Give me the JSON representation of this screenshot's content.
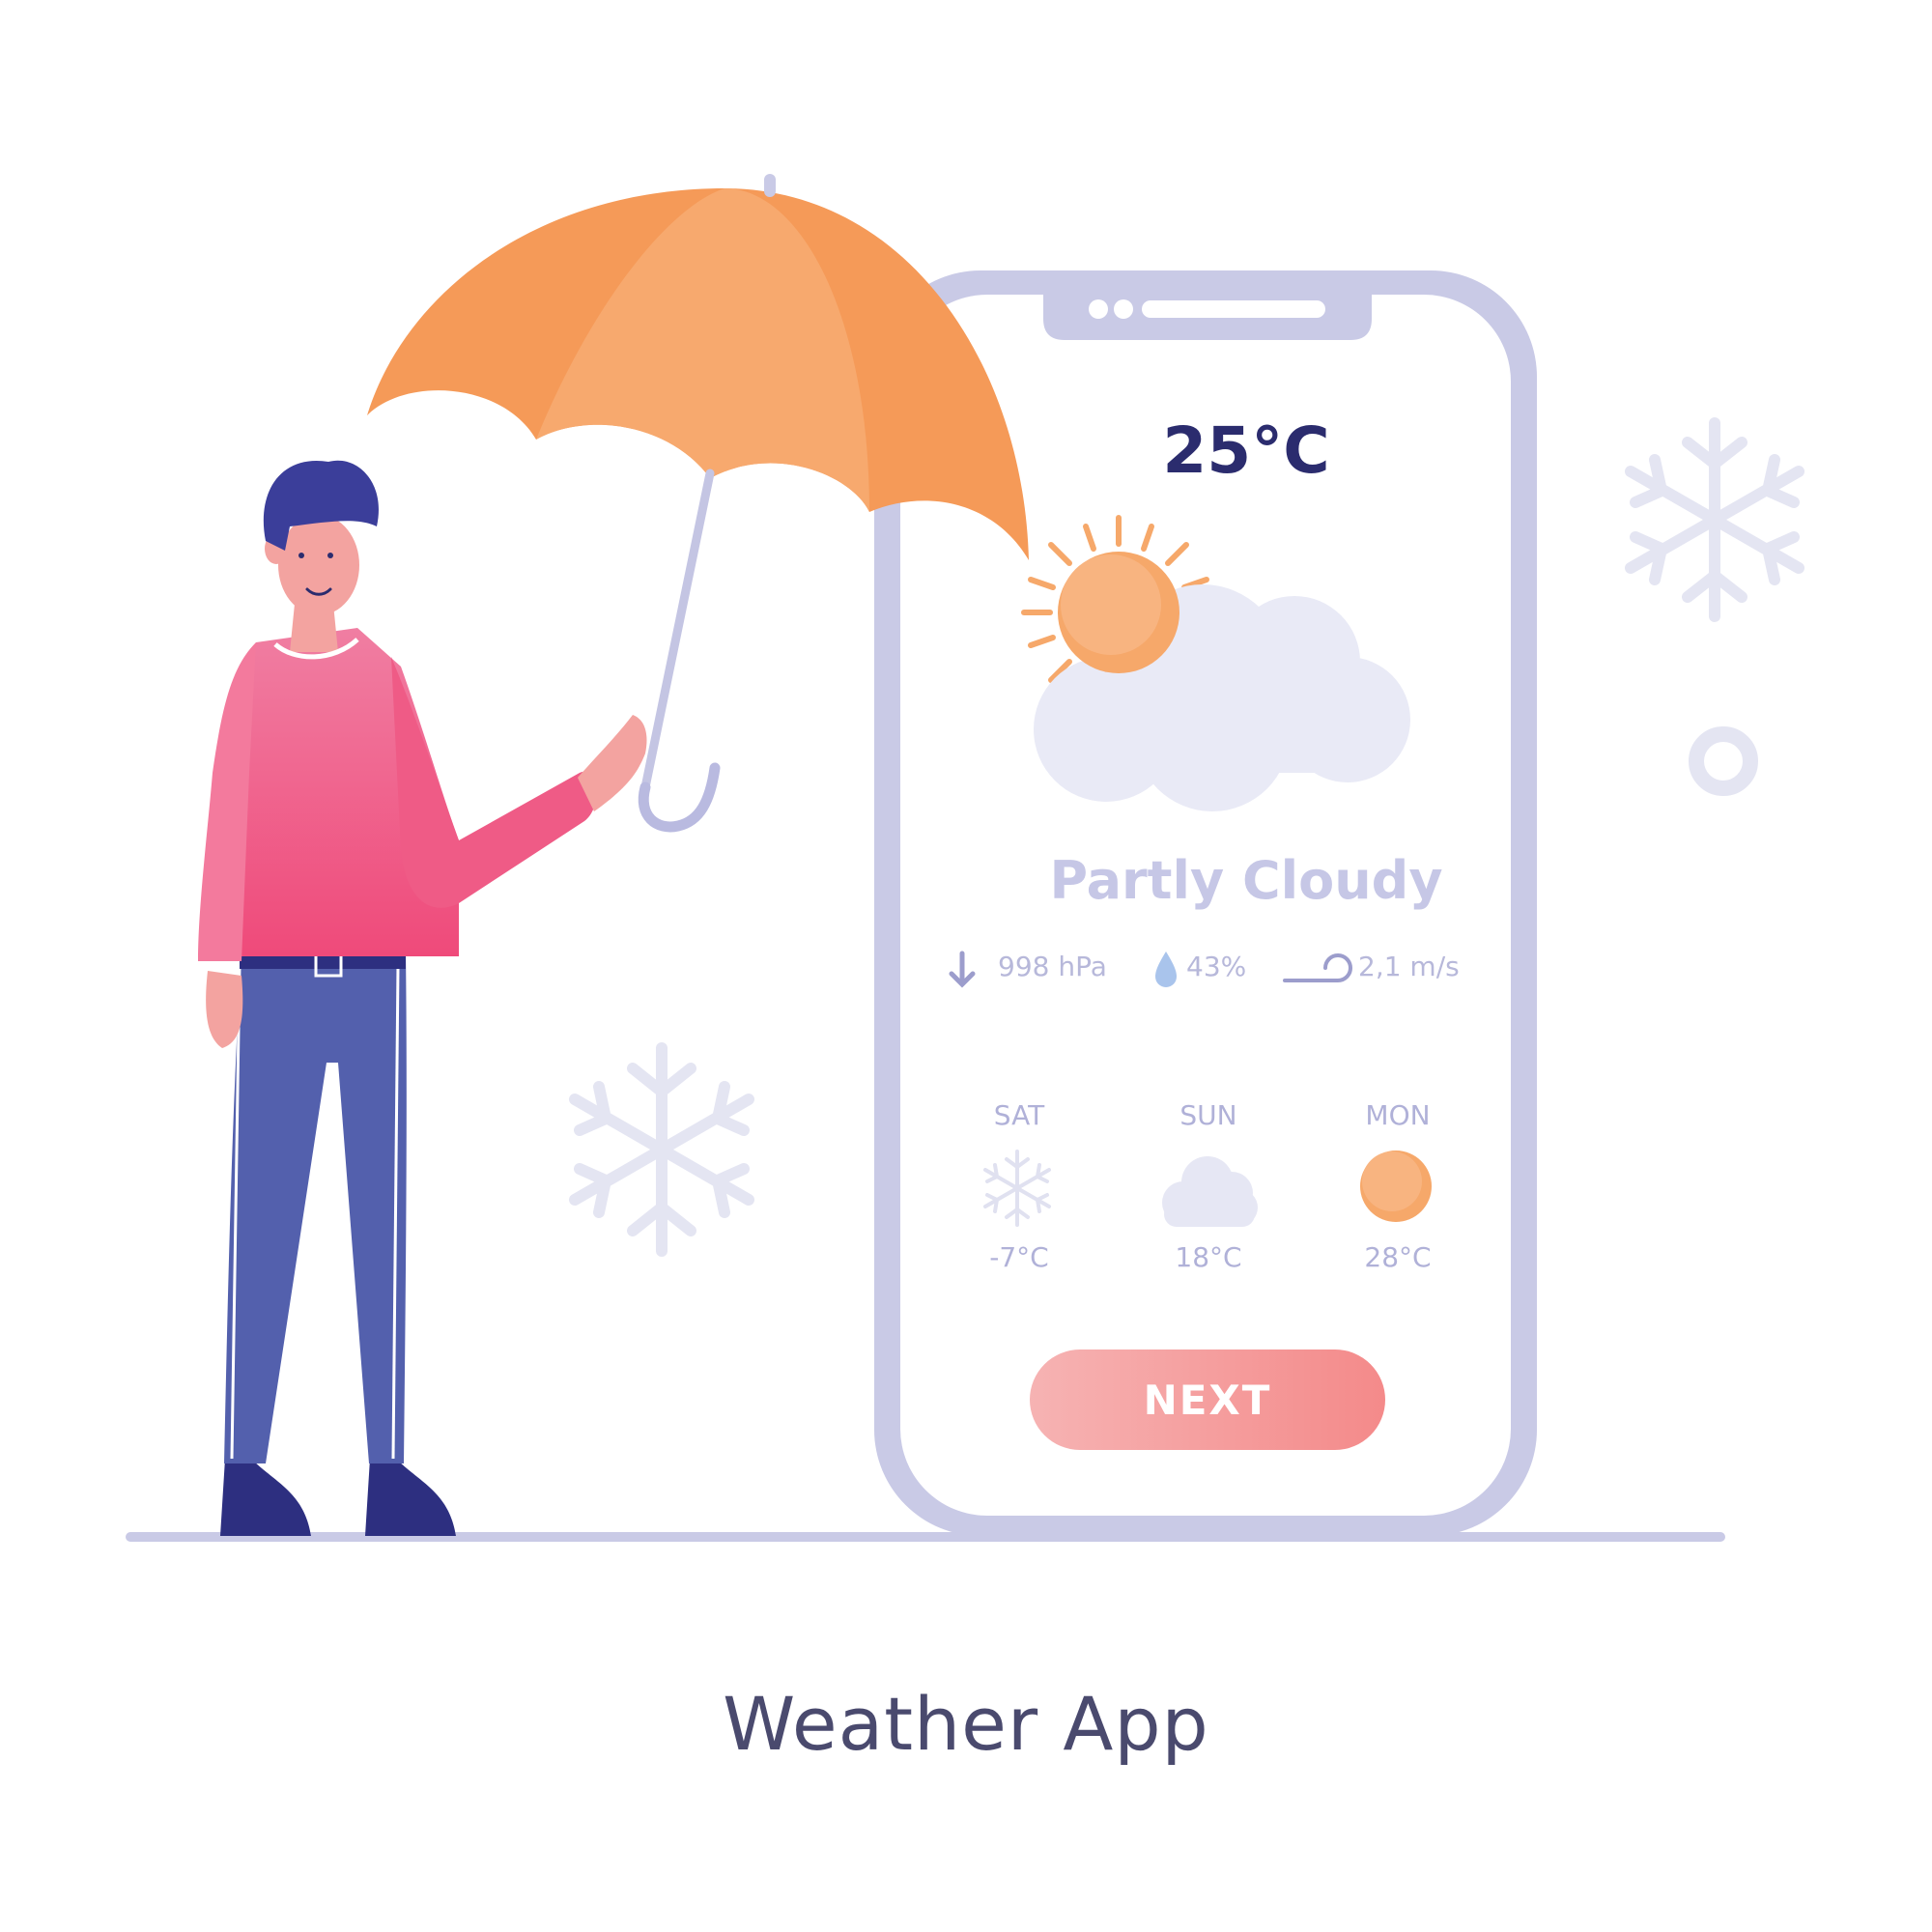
{
  "title": "Weather App",
  "phone": {
    "temperature": "25°C",
    "condition": "Partly Cloudy",
    "stats": {
      "pressure": "998 hPa",
      "humidity": "43%",
      "wind": "2,1 m/s"
    },
    "forecast": [
      {
        "day": "SAT",
        "temp": "-7°C",
        "icon": "snowflake-icon"
      },
      {
        "day": "SUN",
        "temp": "18°C",
        "icon": "cloud-icon"
      },
      {
        "day": "MON",
        "temp": "28°C",
        "icon": "sun-icon"
      }
    ],
    "next_label": "NEXT"
  },
  "colors": {
    "phone_frame": "#c9cae6",
    "umbrella": "#f59a58",
    "sweater": "#ef5b86",
    "pants": "#5360ad",
    "hair": "#3b3e9a",
    "sun": "#f6a86a",
    "cloud": "#e9eaf6",
    "text_dark": "#2b2c6e",
    "button": "#f48a8a"
  }
}
